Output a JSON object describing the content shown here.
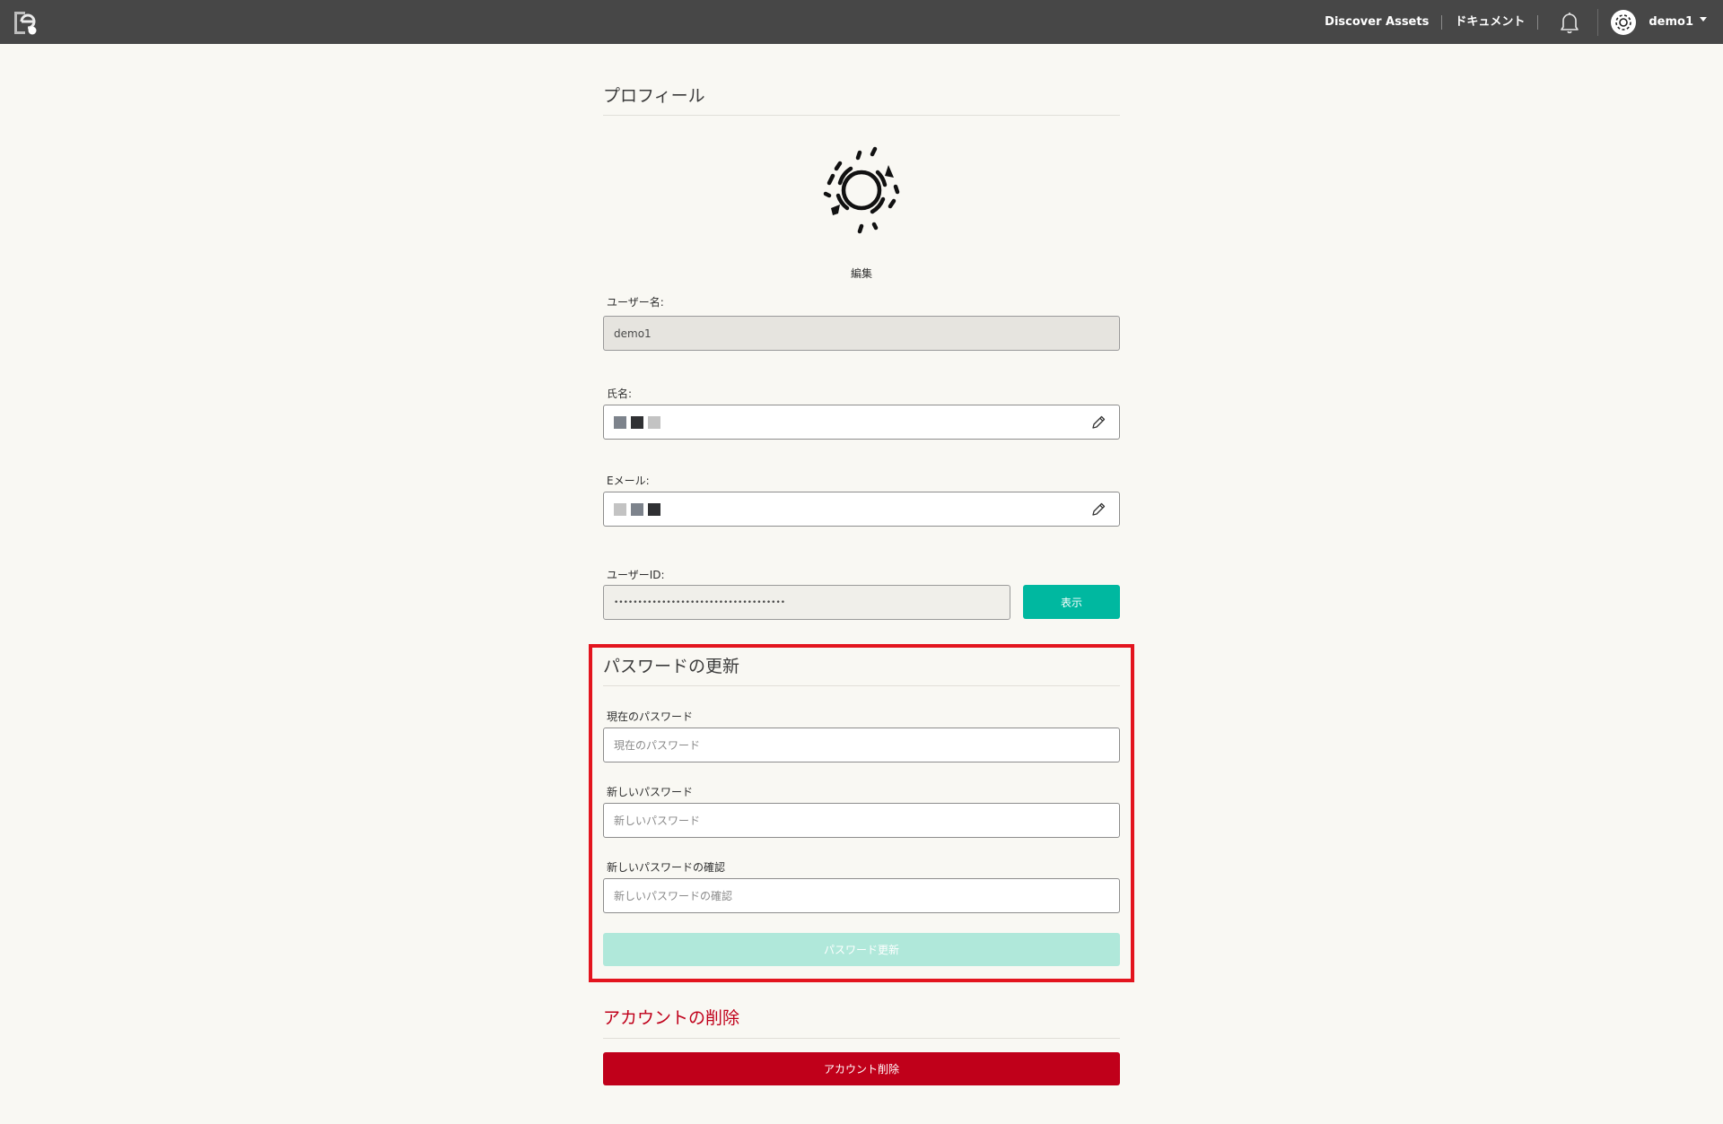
{
  "nav": {
    "discover_label": "Discover Assets",
    "docs_label": "ドキュメント",
    "user_name": "demo1"
  },
  "profile": {
    "title": "プロフィール",
    "edit_label": "編集",
    "username_label": "ユーザー名:",
    "username_value": "demo1",
    "fullname_label": "氏名:",
    "fullname_swatches": [
      "#7d838c",
      "#2f3033",
      "#c3c3c3"
    ],
    "email_label": "Eメール:",
    "email_swatches": [
      "#c3c3c3",
      "#7d838c",
      "#2f3033"
    ],
    "userid_label": "ユーザーID:",
    "userid_value": "••••••••••••••••••••••••••••••••••••",
    "show_button": "表示"
  },
  "password": {
    "title": "パスワードの更新",
    "current_label": "現在のパスワード",
    "current_placeholder": "現在のパスワード",
    "new_label": "新しいパスワード",
    "new_placeholder": "新しいパスワード",
    "confirm_label": "新しいパスワードの確認",
    "confirm_placeholder": "新しいパスワードの確認",
    "submit_button": "パスワード更新"
  },
  "delete_account": {
    "title": "アカウントの削除",
    "button": "アカウント削除"
  },
  "colors": {
    "teal": "#00b8a0",
    "teal_disabled": "#b0e8da",
    "danger": "#c0001a",
    "highlight": "#e3151e"
  },
  "icons": {
    "logo": "logo-icon",
    "bell": "bell-icon",
    "avatar": "avatar-icon",
    "pencil": "pencil-icon"
  }
}
